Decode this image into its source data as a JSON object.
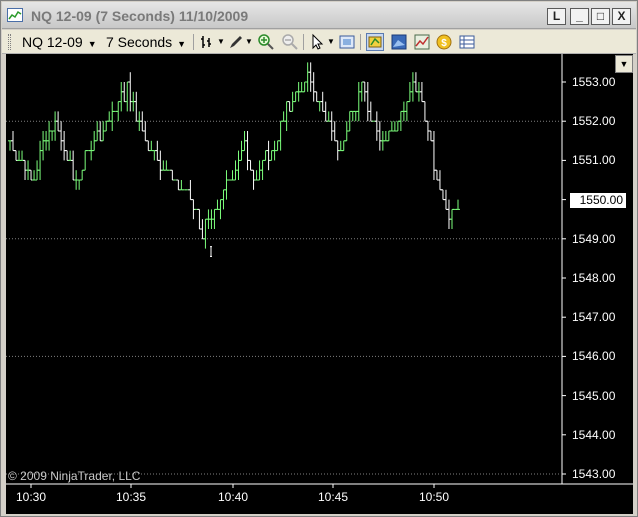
{
  "window": {
    "title": "NQ 12-09 (7 Seconds)  11/10/2009",
    "buttons": {
      "menu": "L",
      "minimize": "_",
      "maximize": "□",
      "close": "X"
    }
  },
  "toolbar": {
    "instrument": "NQ 12-09",
    "interval": "7 Seconds",
    "icons": [
      "bar-type-icon",
      "drawing-tool-icon",
      "zoom-in-icon",
      "zoom-out-icon",
      "pointer-icon",
      "properties-icon",
      "data-box-icon",
      "chart-style-icon",
      "indicators-icon",
      "strategy-icon",
      "data-series-icon"
    ]
  },
  "chart": {
    "copyright": "© 2009 NinjaTrader, LLC",
    "current_price": "1550.00",
    "y_labels": [
      "1553.00",
      "1552.00",
      "1551.00",
      "1550.00",
      "1549.00",
      "1548.00",
      "1547.00",
      "1546.00",
      "1545.00",
      "1544.00",
      "1543.00"
    ],
    "x_labels": [
      "10:30",
      "10:35",
      "10:40",
      "10:45",
      "10:50"
    ],
    "colors": {
      "background": "#000000",
      "up_bar": "#7cff7c",
      "down_bar": "#ffffff",
      "grid": "#808080"
    }
  },
  "chart_data": {
    "type": "line",
    "title": "",
    "xlabel": "",
    "ylabel": "",
    "ylim": [
      1543.0,
      1553.5
    ],
    "x": [
      "10:30",
      "10:30:30",
      "10:31",
      "10:31:30",
      "10:32",
      "10:32:30",
      "10:33",
      "10:33:30",
      "10:34",
      "10:34:30",
      "10:35",
      "10:35:30",
      "10:36",
      "10:36:30",
      "10:37",
      "10:37:30",
      "10:38",
      "10:38:30",
      "10:39",
      "10:39:30",
      "10:40",
      "10:40:30",
      "10:41",
      "10:41:30",
      "10:42",
      "10:42:30",
      "10:43",
      "10:43:30",
      "10:44",
      "10:44:30",
      "10:45",
      "10:45:30",
      "10:46",
      "10:46:30",
      "10:47",
      "10:47:30",
      "10:48",
      "10:48:30",
      "10:49",
      "10:49:30",
      "10:50",
      "10:50:30",
      "10:51"
    ],
    "series": [
      {
        "values": [
          1551.5,
          1551.0,
          1550.6,
          1551.2,
          1552.0,
          1551.3,
          1550.4,
          1551.0,
          1551.6,
          1552.0,
          1552.3,
          1552.8,
          1552.1,
          1551.3,
          1550.9,
          1550.7,
          1550.3,
          1549.9,
          1549.2,
          1549.6,
          1550.2,
          1550.8,
          1551.3,
          1550.5,
          1551.0,
          1551.5,
          1552.3,
          1552.8,
          1553.1,
          1552.4,
          1551.8,
          1551.3,
          1552.1,
          1552.8,
          1552.0,
          1551.5,
          1551.8,
          1552.4,
          1553.0,
          1552.0,
          1550.5,
          1549.7,
          1549.9
        ]
      }
    ],
    "lows": [
      {
        "x": "10:39",
        "value": 1548.6
      }
    ],
    "current_price": 1550.0
  }
}
